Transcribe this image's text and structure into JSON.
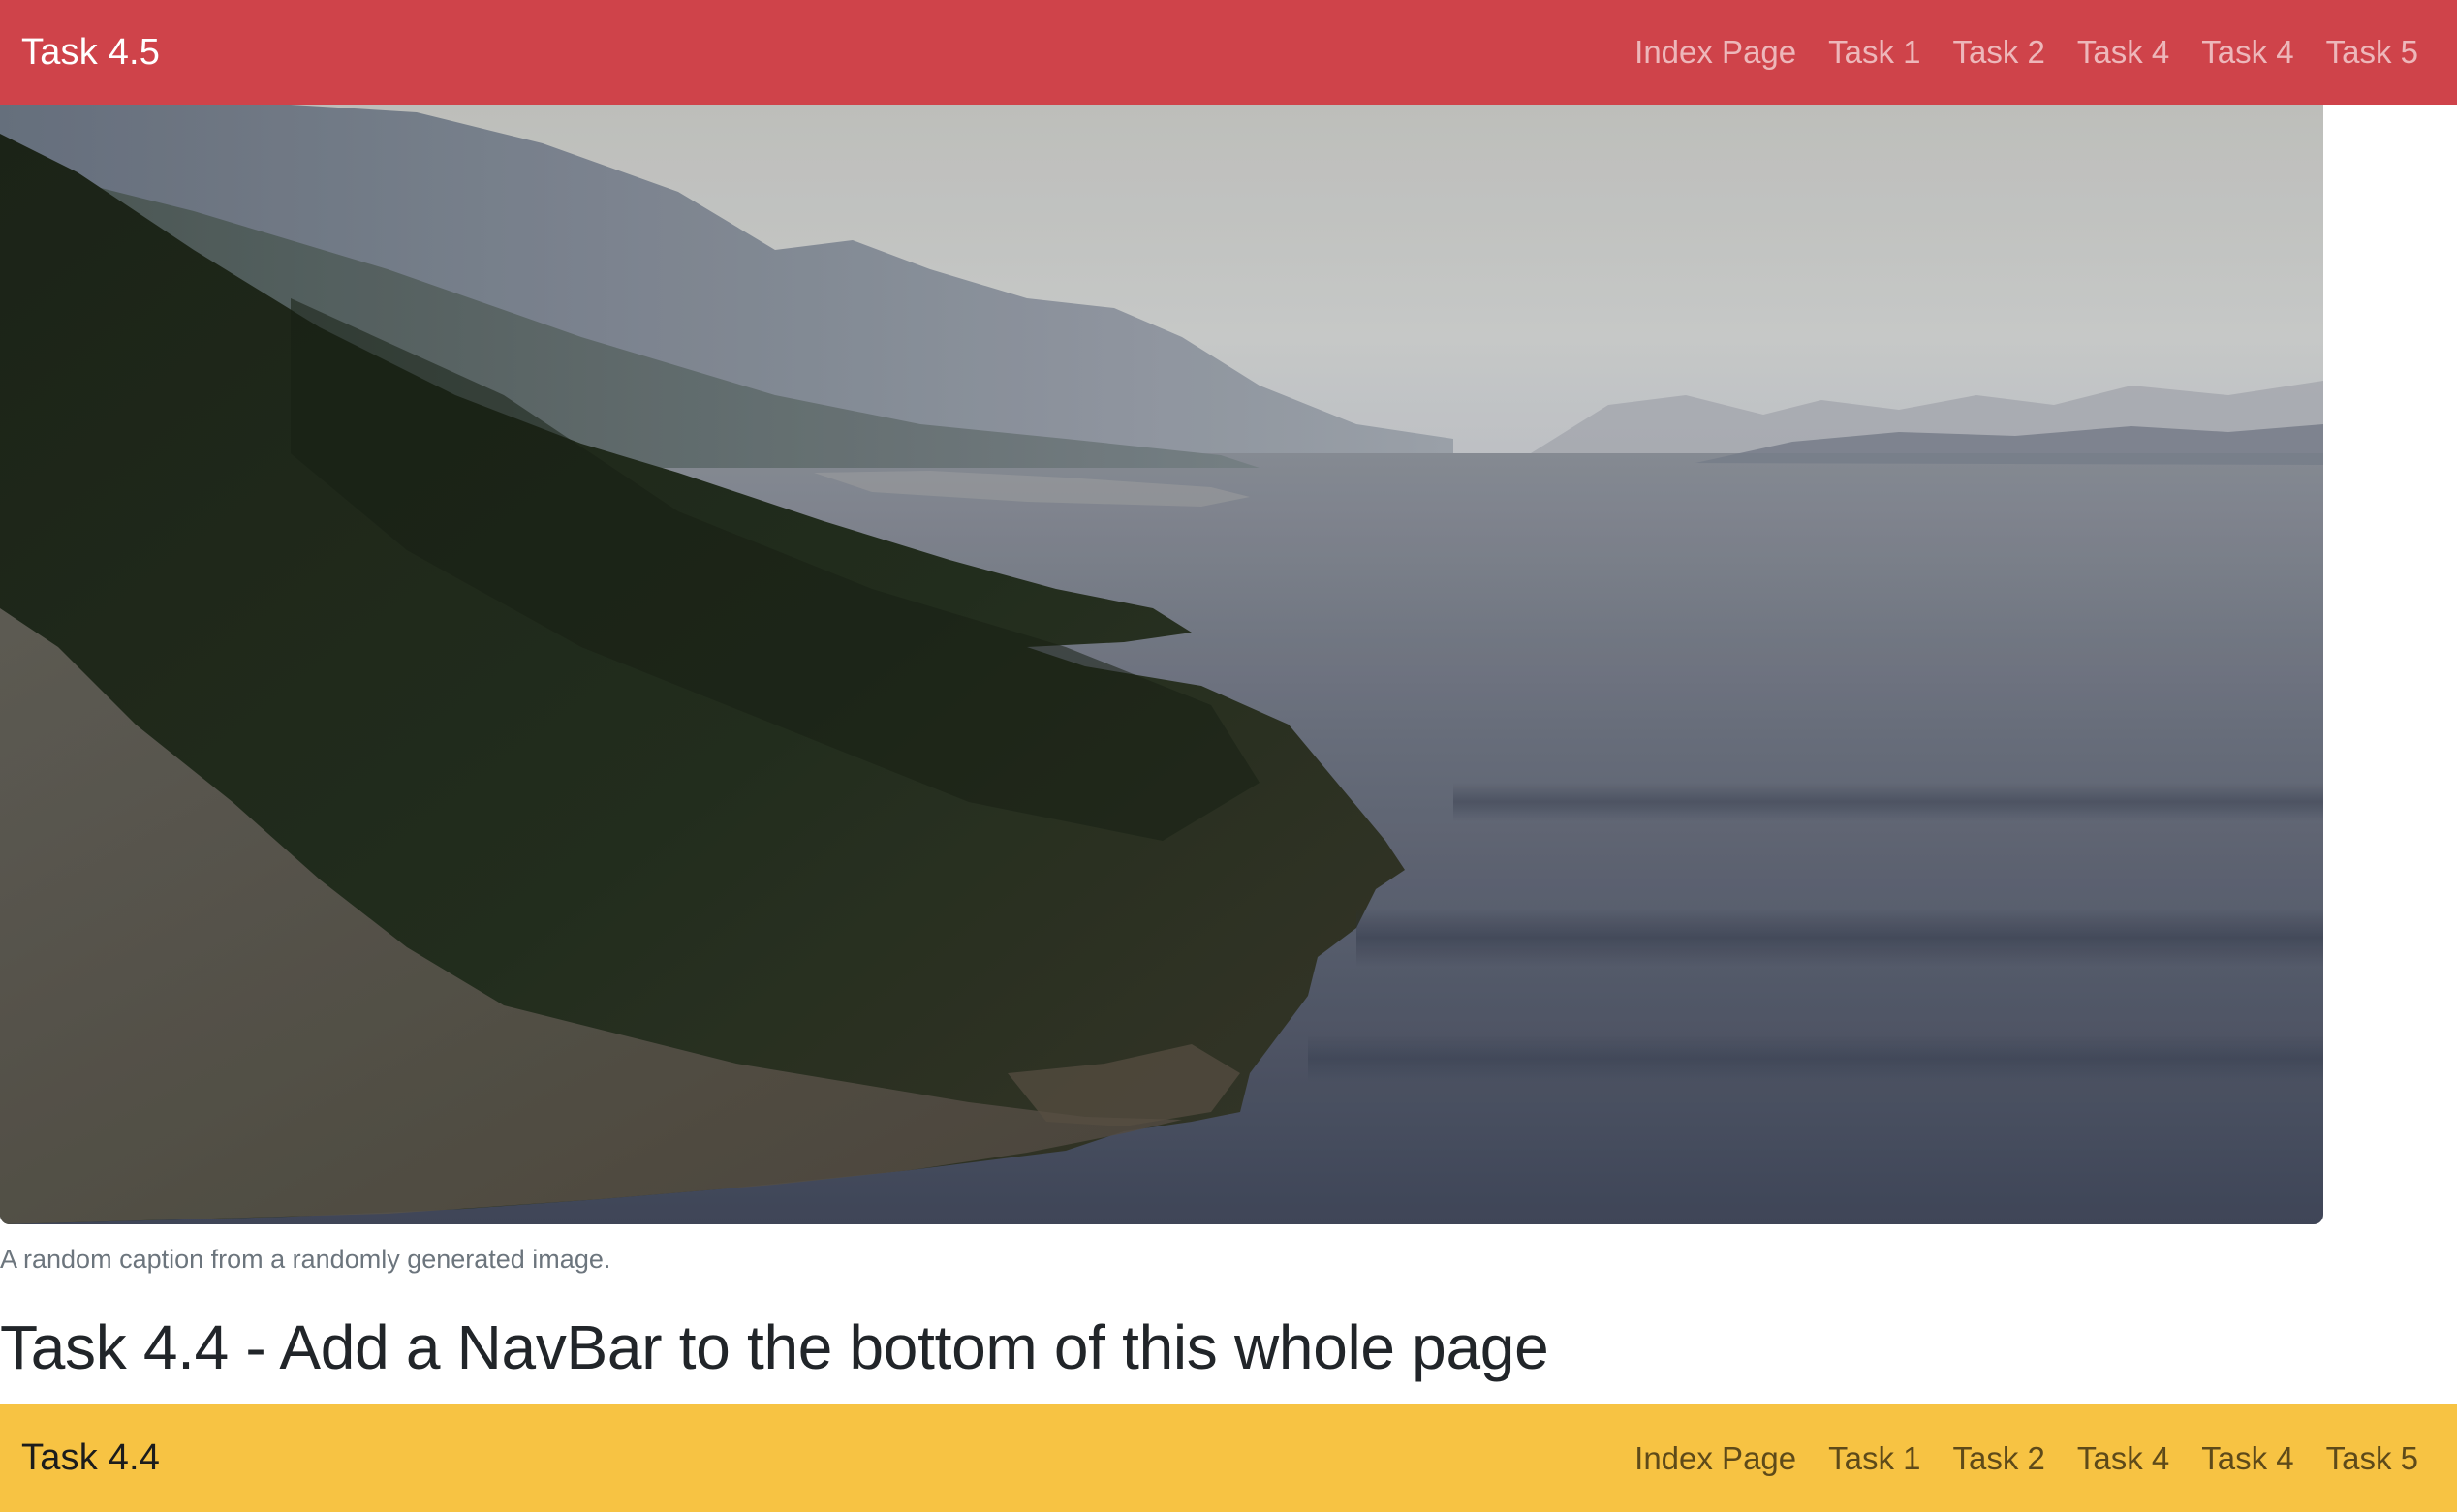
{
  "top_navbar": {
    "brand": "Task 4.5",
    "color": "#cf434a",
    "links": [
      {
        "label": "Index Page"
      },
      {
        "label": "Task 1"
      },
      {
        "label": "Task 2"
      },
      {
        "label": "Task 4"
      },
      {
        "label": "Task 4"
      },
      {
        "label": "Task 5"
      }
    ]
  },
  "figure": {
    "image_subject": "coastal-mountain-landscape",
    "caption": "A random caption from a randomly generated image."
  },
  "main": {
    "heading": "Task 4.4 - Add a NavBar to the bottom of this whole page"
  },
  "bottom_navbar": {
    "brand": "Task 4.4",
    "color": "#f7c343",
    "links": [
      {
        "label": "Index Page"
      },
      {
        "label": "Task 1"
      },
      {
        "label": "Task 2"
      },
      {
        "label": "Task 4"
      },
      {
        "label": "Task 4"
      },
      {
        "label": "Task 5"
      }
    ]
  }
}
